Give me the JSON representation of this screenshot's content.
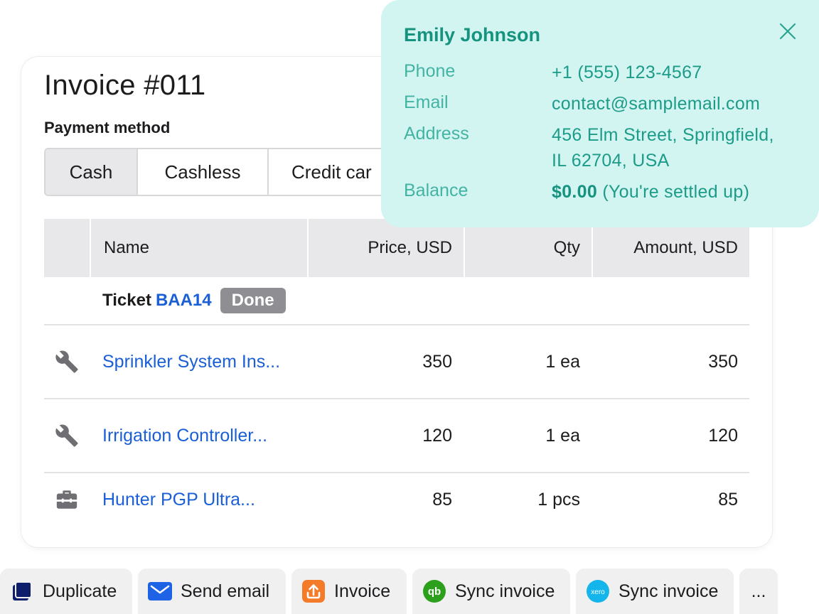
{
  "invoice": {
    "title": "Invoice #011",
    "payment_method_label": "Payment method",
    "payment_methods": [
      "Cash",
      "Cashless",
      "Credit car"
    ],
    "selected_payment_method": "Cash"
  },
  "table": {
    "headers": [
      "Name",
      "Price, USD",
      "Qty",
      "Amount, USD"
    ],
    "group": {
      "label": "Ticket",
      "ticket_id": "BAA14",
      "status": "Done"
    },
    "rows": [
      {
        "icon": "wrench-icon",
        "name": "Sprinkler System Ins...",
        "price": "350",
        "qty": "1 ea",
        "amount": "350"
      },
      {
        "icon": "wrench-icon",
        "name": "Irrigation Controller...",
        "price": "120",
        "qty": "1 ea",
        "amount": "120"
      },
      {
        "icon": "toolbox-icon",
        "name": "Hunter PGP Ultra...",
        "price": "85",
        "qty": "1 pcs",
        "amount": "85"
      }
    ]
  },
  "contact": {
    "name": "Emily Johnson",
    "phone_label": "Phone",
    "phone": "+1 (555) 123-4567",
    "email_label": "Email",
    "email": "contact@samplemail.com",
    "address_label": "Address",
    "address_line1": "456 Elm Street, Springfield,",
    "address_line2": "IL 62704, USA",
    "balance_label": "Balance",
    "balance_amount": "$0.00",
    "balance_note": "(You're settled up)"
  },
  "actions": {
    "duplicate": "Duplicate",
    "send_email": "Send email",
    "invoice": "Invoice",
    "sync_qb": "Sync invoice",
    "sync_xero": "Sync invoice",
    "more": "...",
    "qb_icon_text": "qb",
    "xero_icon_text": "xero"
  },
  "colors": {
    "link": "#1a5fd6",
    "popup_bg": "#d3f5f2",
    "popup_text": "#15937f",
    "badge_bg": "#8e8e93",
    "email_icon": "#1e63e6",
    "invoice_icon": "#f47b2a",
    "qb_green": "#2ca01c",
    "xero_blue": "#13b5ea"
  }
}
